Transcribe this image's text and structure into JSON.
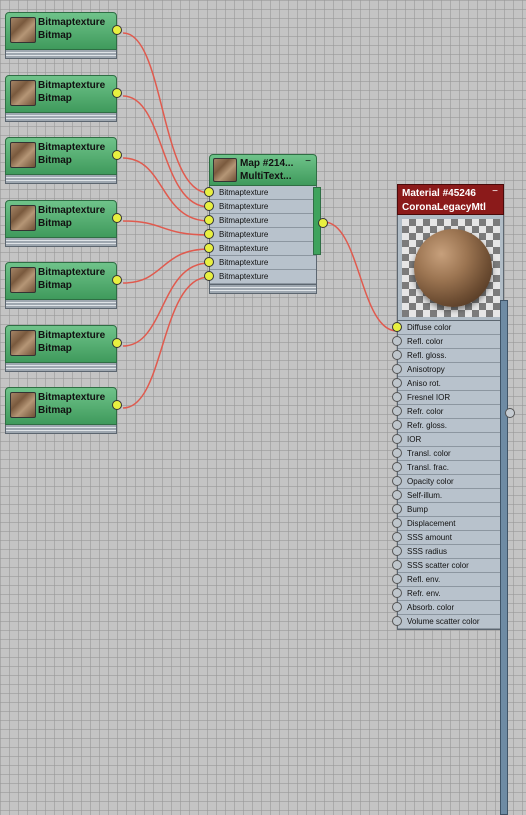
{
  "bitmap_nodes": [
    {
      "title": "Bitmaptexture",
      "subtitle": "Bitmap"
    },
    {
      "title": "Bitmaptexture",
      "subtitle": "Bitmap"
    },
    {
      "title": "Bitmaptexture",
      "subtitle": "Bitmap"
    },
    {
      "title": "Bitmaptexture",
      "subtitle": "Bitmap"
    },
    {
      "title": "Bitmaptexture",
      "subtitle": "Bitmap"
    },
    {
      "title": "Bitmaptexture",
      "subtitle": "Bitmap"
    },
    {
      "title": "Bitmaptexture",
      "subtitle": "Bitmap"
    }
  ],
  "multi_node": {
    "title": "Map #214...",
    "subtitle": "MultiText...",
    "minimize": "−",
    "slots": [
      "Bitmaptexture",
      "Bitmaptexture",
      "Bitmaptexture",
      "Bitmaptexture",
      "Bitmaptexture",
      "Bitmaptexture",
      "Bitmaptexture"
    ]
  },
  "material_node": {
    "title": "Material #45246",
    "subtitle": "CoronaLegacyMtl",
    "minimize": "−",
    "slots": [
      "Diffuse color",
      "Refl. color",
      "Refl. gloss.",
      "Anisotropy",
      "Aniso rot.",
      "Fresnel IOR",
      "Refr. color",
      "Refr. gloss.",
      "IOR",
      "Transl. color",
      "Transl. frac.",
      "Opacity color",
      "Self-illum.",
      "Bump",
      "Displacement",
      "SSS amount",
      "SSS radius",
      "SSS scatter color",
      "Refl. env.",
      "Refr. env.",
      "Absorb. color",
      "Volume scatter color"
    ]
  },
  "colors": {
    "wire": "#e05a4e",
    "node_header_green": "#4faa6a",
    "material_header": "#8b1a1a",
    "socket_active": "#e8f040"
  }
}
